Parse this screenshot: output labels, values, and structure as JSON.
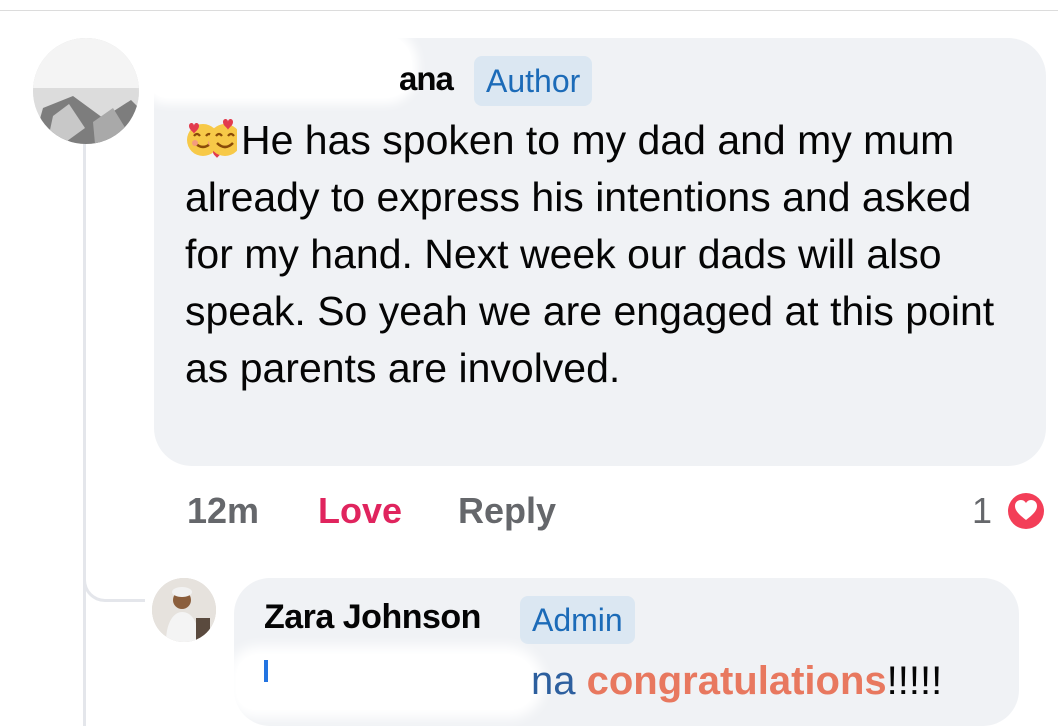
{
  "comment": {
    "author_name_visible": "ana",
    "author_badge": "Author",
    "emoji_prefix": "smiling-face-with-hearts",
    "text": "He has spoken to my dad and my mum already to express his intentions and asked for my hand. Next week our dads will also speak. So yeah we are engaged at this point as parents are involved.",
    "time": "12m",
    "love_label": "Love",
    "reply_label": "Reply",
    "reaction_count": "1",
    "reaction_type": "love"
  },
  "reply": {
    "author_name": "Zara Johnson",
    "author_badge": "Admin",
    "mention_visible": "na",
    "highlight_word": "congratulations",
    "suffix": "!!!!!"
  },
  "colors": {
    "bubble": "#f0f2f5",
    "badge_bg": "#dbe7f2",
    "badge_text": "#1c6bb8",
    "love": "#e0245e",
    "muted": "#65676b",
    "congrats": "#e8785f"
  }
}
